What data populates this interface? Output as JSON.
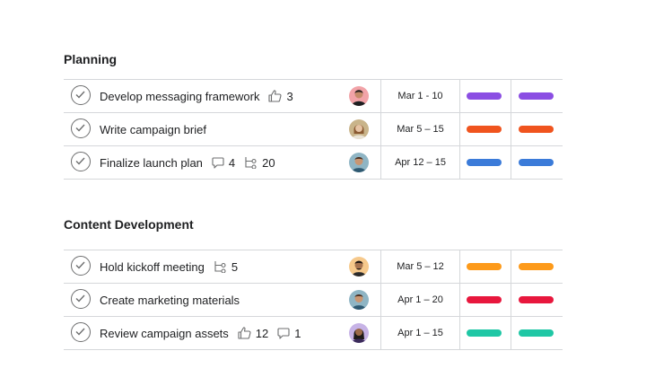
{
  "sections": [
    {
      "title": "Planning",
      "rows": [
        {
          "task": "Develop messaging framework",
          "likes": "3",
          "date": "Mar 1 - 10",
          "color": "#8b4ee3"
        },
        {
          "task": "Write campaign brief",
          "date": "Mar 5 – 15",
          "color": "#f0541e"
        },
        {
          "task": "Finalize launch plan",
          "comments": "4",
          "subtasks": "20",
          "date": "Apr 12 – 15",
          "color": "#3b7bd9"
        }
      ]
    },
    {
      "title": "Content Development",
      "rows": [
        {
          "task": "Hold kickoff meeting",
          "subtasks": "5",
          "date": "Mar 5 – 12",
          "color": "#fd9a1a"
        },
        {
          "task": "Create marketing materials",
          "date": "Apr 1 – 20",
          "color": "#e8173d"
        },
        {
          "task": "Review campaign assets",
          "likes": "12",
          "comments": "1",
          "date": "Apr 1 – 15",
          "color": "#1fc7a5"
        }
      ]
    }
  ]
}
